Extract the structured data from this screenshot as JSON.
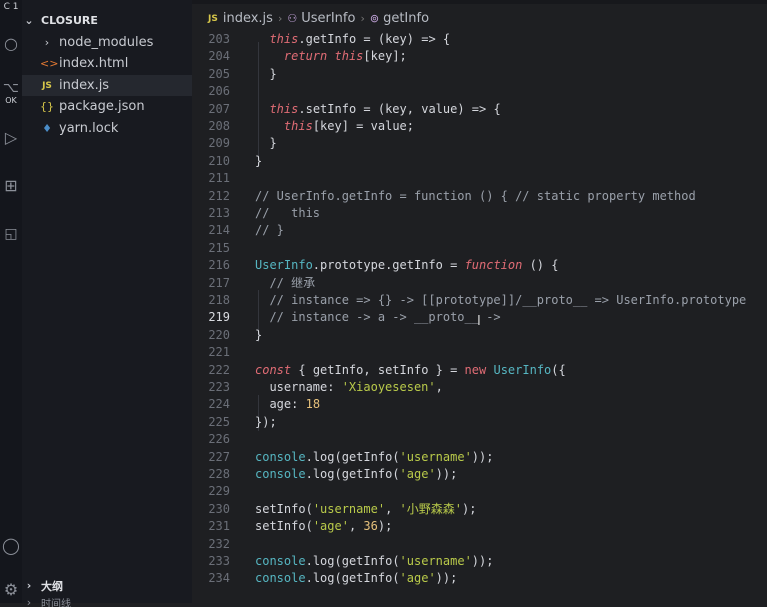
{
  "sidebar": {
    "folder": "CLOSURE",
    "items": [
      {
        "name": "node_modules",
        "icon": ">",
        "type": "folder"
      },
      {
        "name": "index.html",
        "icon": "<>",
        "type": "html"
      },
      {
        "name": "index.js",
        "icon": "JS",
        "type": "js",
        "active": true
      },
      {
        "name": "package.json",
        "icon": "{}",
        "type": "json"
      },
      {
        "name": "yarn.lock",
        "icon": "lock",
        "type": "yarn"
      }
    ],
    "outline_label": "大纲",
    "bottom_clip": "时间线"
  },
  "breadcrumb": {
    "file": "index.js",
    "class": "UserInfo",
    "method": "getInfo"
  },
  "code": {
    "current_line": 219,
    "lines": [
      {
        "n": 203,
        "text": "    this.getInfo = (key) => {"
      },
      {
        "n": 204,
        "text": "      return this[key];"
      },
      {
        "n": 205,
        "text": "    }"
      },
      {
        "n": 206,
        "text": ""
      },
      {
        "n": 207,
        "text": "    this.setInfo = (key, value) => {"
      },
      {
        "n": 208,
        "text": "      this[key] = value;"
      },
      {
        "n": 209,
        "text": "    }"
      },
      {
        "n": 210,
        "text": "  }"
      },
      {
        "n": 211,
        "text": ""
      },
      {
        "n": 212,
        "text": "  // UserInfo.getInfo = function () { // static property method"
      },
      {
        "n": 213,
        "text": "  //   this"
      },
      {
        "n": 214,
        "text": "  // }"
      },
      {
        "n": 215,
        "text": ""
      },
      {
        "n": 216,
        "text": "  UserInfo.prototype.getInfo = function () {"
      },
      {
        "n": 217,
        "text": "    // 继承"
      },
      {
        "n": 218,
        "text": "    // instance => {} -> [[prototype]]/__proto__ => UserInfo.prototype"
      },
      {
        "n": 219,
        "text": "    // instance -> a -> __proto__ ->"
      },
      {
        "n": 220,
        "text": "  }"
      },
      {
        "n": 221,
        "text": ""
      },
      {
        "n": 222,
        "text": "  const { getInfo, setInfo } = new UserInfo({"
      },
      {
        "n": 223,
        "text": "    username: 'Xiaoyesesen',"
      },
      {
        "n": 224,
        "text": "    age: 18"
      },
      {
        "n": 225,
        "text": "  });"
      },
      {
        "n": 226,
        "text": ""
      },
      {
        "n": 227,
        "text": "  console.log(getInfo('username'));"
      },
      {
        "n": 228,
        "text": "  console.log(getInfo('age'));"
      },
      {
        "n": 229,
        "text": ""
      },
      {
        "n": 230,
        "text": "  setInfo('username', '小野森森');"
      },
      {
        "n": 231,
        "text": "  setInfo('age', 36);"
      },
      {
        "n": 232,
        "text": ""
      },
      {
        "n": 233,
        "text": "  console.log(getInfo('username'));"
      },
      {
        "n": 234,
        "text": "  console.log(getInfo('age'));"
      }
    ]
  }
}
